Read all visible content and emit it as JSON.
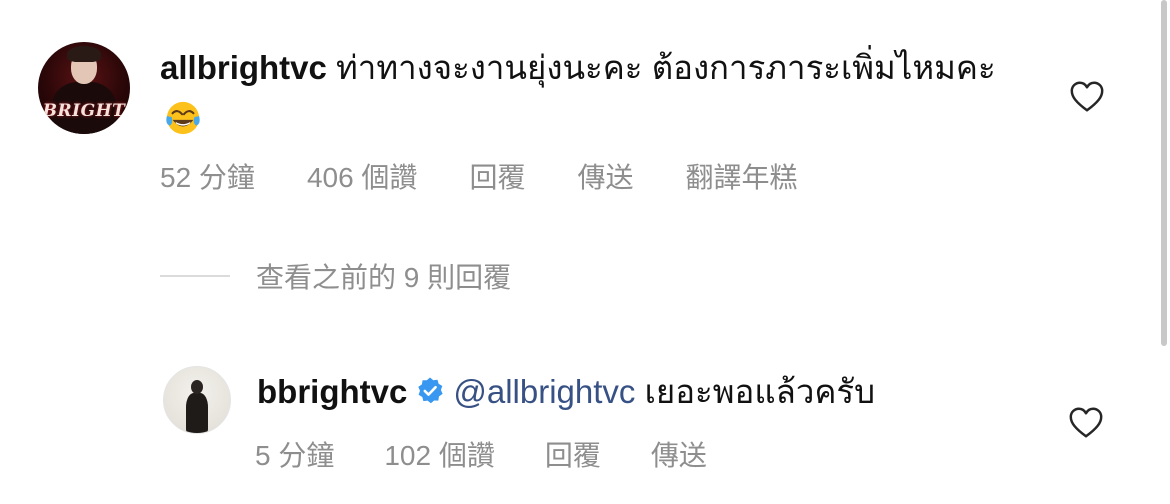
{
  "comment": {
    "username": "allbrightvc",
    "text": "ท่าทางจะงานยุ่งนะคะ ต้องการภาระเพิ่มไหมคะ",
    "emoji_icon": "face-with-tears-of-joy-emoji",
    "avatar_brand_text": "BRIGHT",
    "time": "52 分鐘",
    "likes": "406 個讚",
    "reply_label": "回覆",
    "send_label": "傳送",
    "translate_label": "翻譯年糕"
  },
  "view_replies_label": "查看之前的 9 則回覆",
  "reply": {
    "username": "bbrightvc",
    "verified_icon": "verified-badge-icon",
    "mention": "@allbrightvc",
    "text": "เยอะพอแล้วครับ",
    "time": "5 分鐘",
    "likes": "102 個讚",
    "reply_label": "回覆",
    "send_label": "傳送"
  },
  "colors": {
    "meta_gray": "#8e8e8e",
    "mention_blue": "#385185",
    "verified_blue": "#3897f0"
  }
}
